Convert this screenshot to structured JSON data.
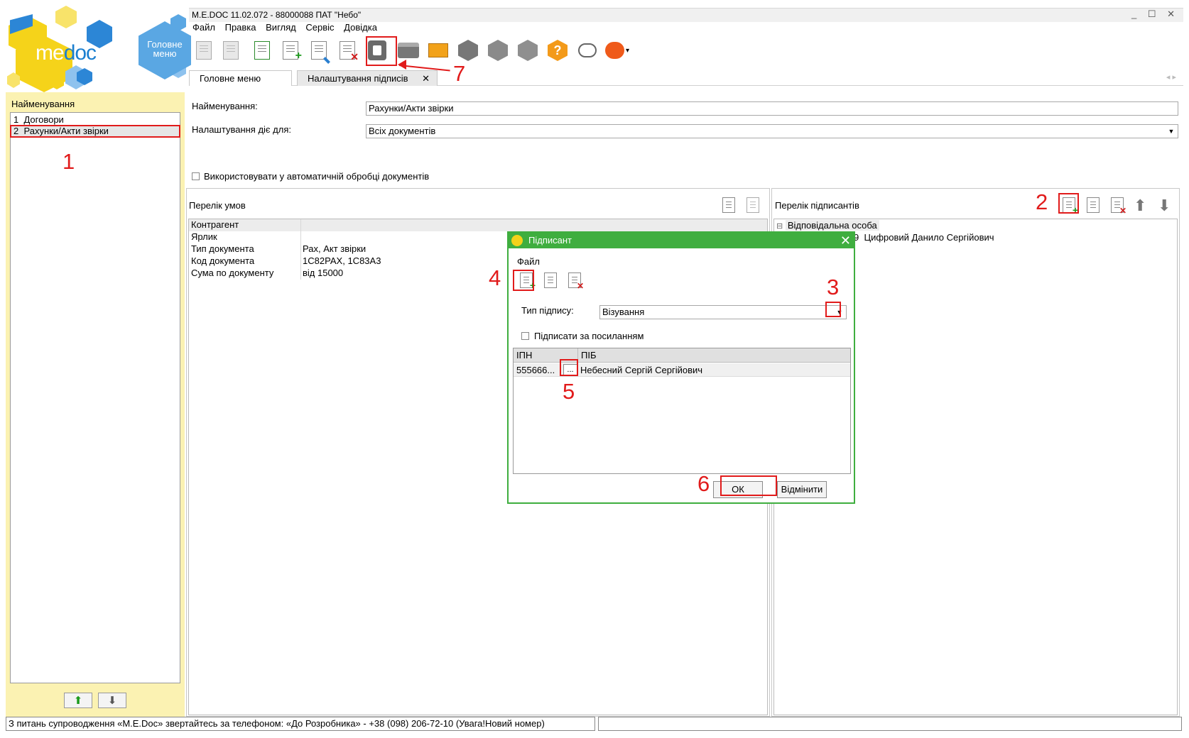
{
  "logo": {
    "text_me": "me",
    "text_doc": "doc"
  },
  "home_button": {
    "label": "Головне меню"
  },
  "window": {
    "title": "M.E.DOC 11.02.072 - 88000088 ПАТ \"Небо\"",
    "controls": "_ ☐ ✕"
  },
  "menu": [
    "Файл",
    "Правка",
    "Вигляд",
    "Сервіс",
    "Довідка"
  ],
  "toolbar": {
    "icons": [
      "open-folder-icon",
      "delete-folder-icon",
      "documents-icon",
      "add-document-icon",
      "edit-document-icon",
      "delete-document-icon",
      "signature-settings-icon",
      "printer-icon",
      "mail-send-icon",
      "search-icon",
      "inbox-icon",
      "check-shield-icon",
      "help-icon",
      "chat-icon",
      "feedback-icon"
    ],
    "dropdown_glyph": "▾"
  },
  "tabs": [
    {
      "label": "Головне меню"
    },
    {
      "label": "Налаштування підписів",
      "close": "✕"
    }
  ],
  "left_panel": {
    "header": "Найменування",
    "rows": [
      {
        "num": "1",
        "label": "Договори"
      },
      {
        "num": "2",
        "label": "Рахунки/Акти звірки"
      }
    ],
    "up_glyph": "⬆",
    "down_glyph": "⬇"
  },
  "form": {
    "name_label": "Найменування:",
    "name_value": "Рахунки/Акти звірки",
    "applies_label": "Налаштування діє для:",
    "applies_value": "Всіх документів",
    "auto_process_label": "Використовувати у автоматичній обробці документів"
  },
  "conditions": {
    "title": "Перелік умов",
    "rows": [
      {
        "key": "Контрагент",
        "value": ""
      },
      {
        "key": "Ярлик",
        "value": ""
      },
      {
        "key": "Тип документа",
        "value": "Рах, Акт звірки"
      },
      {
        "key": "Код документа",
        "value": "1С82РАХ, 1С83А3"
      },
      {
        "key": "Сума по документу",
        "value": "від 15000"
      }
    ]
  },
  "signers": {
    "title": "Перелік підписантів",
    "tree_root": "Відповідальна особа",
    "tree_expand": "⊟",
    "tree_child": "Цифровий Данило Сергійович",
    "tree_child_prefix": "9"
  },
  "dialog": {
    "title": "Підписант",
    "file_label": "Файл",
    "sign_type_label": "Тип підпису:",
    "sign_type_value": "Візування",
    "sign_by_link_label": "Підписати за посиланням",
    "grid_headers": [
      "ІПН",
      "ПІБ"
    ],
    "grid_row": {
      "ipn": "555666...",
      "ellipsis": "...",
      "name": "Небесний Сергій Сергійович"
    },
    "ok_label": "ОК",
    "cancel_label": "Відмінити"
  },
  "annotations": [
    "1",
    "2",
    "3",
    "4",
    "5",
    "6",
    "7"
  ],
  "status_bar": {
    "text": "З питань супроводження «M.E.Doc» звертайтесь за телефоном: «До Розробника» - +38 (098) 206-72-10 (Увага!Новий номер)"
  },
  "colors": {
    "accent_green": "#3fae3f",
    "annotation_red": "#e11b1b",
    "left_panel_yellow": "#fbf2b2",
    "logo_yellow": "#f5d31a",
    "logo_blue": "#1b7fd0"
  }
}
